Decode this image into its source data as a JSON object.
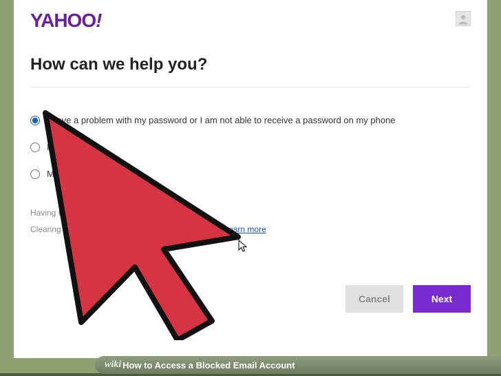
{
  "brand": {
    "name": "YAHOO",
    "bang": "!"
  },
  "heading": "How can we help you?",
  "options": [
    {
      "label": "I have a problem with my password or I am not able to receive a password on my phone",
      "selected": true
    },
    {
      "label": "I forg",
      "selected": false
    },
    {
      "label": "My acc",
      "selected": false
    }
  ],
  "help": {
    "line1": "Having repeated d",
    "line2_prefix": "Clearing your browse",
    "learn_more": "Learn more"
  },
  "buttons": {
    "cancel": "Cancel",
    "next": "Next"
  },
  "footer": {
    "wiki": "wiki",
    "title": "How to Access a Blocked Email Account"
  }
}
